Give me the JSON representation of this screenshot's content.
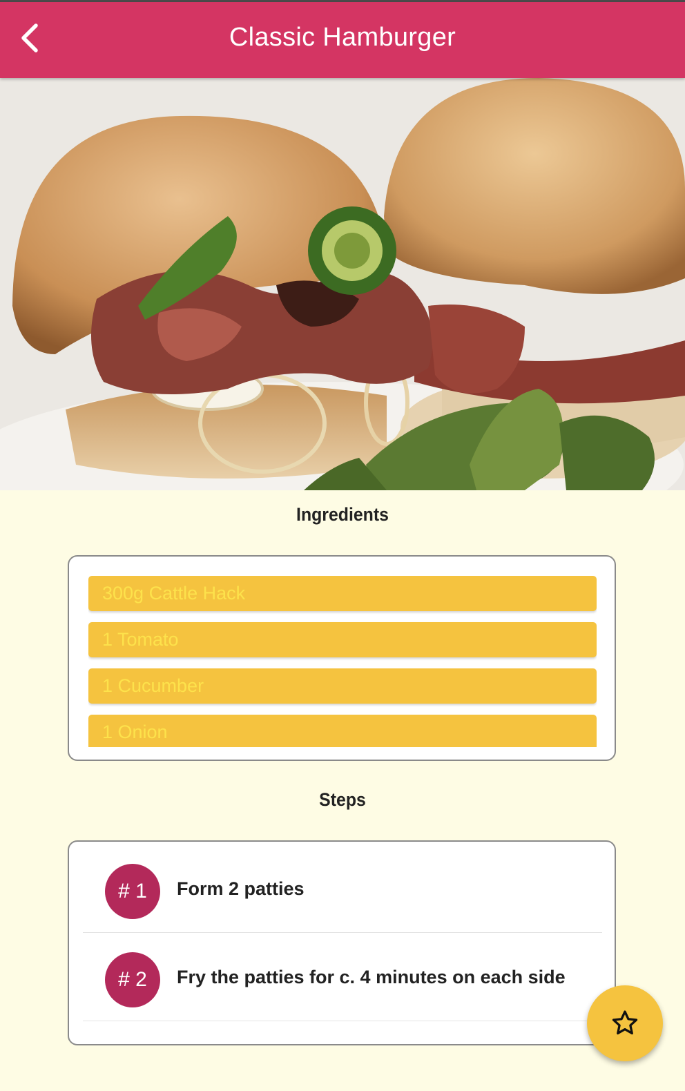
{
  "appbar": {
    "title": "Classic Hamburger",
    "back_icon": "chevron-left-icon"
  },
  "colors": {
    "primary": "#d43563",
    "accent": "#f5c33f",
    "step_badge": "#b3295a",
    "background": "#fefce4"
  },
  "ingredients": {
    "heading": "Ingredients",
    "items": [
      "300g Cattle Hack",
      "1 Tomato",
      "1 Cucumber",
      "1 Onion"
    ]
  },
  "steps": {
    "heading": "Steps",
    "items": [
      {
        "number": "# 1",
        "text": "Form 2 patties"
      },
      {
        "number": "# 2",
        "text": "Fry the patties for c. 4 minutes on each side"
      }
    ]
  },
  "fab": {
    "icon": "star-outline-icon"
  }
}
